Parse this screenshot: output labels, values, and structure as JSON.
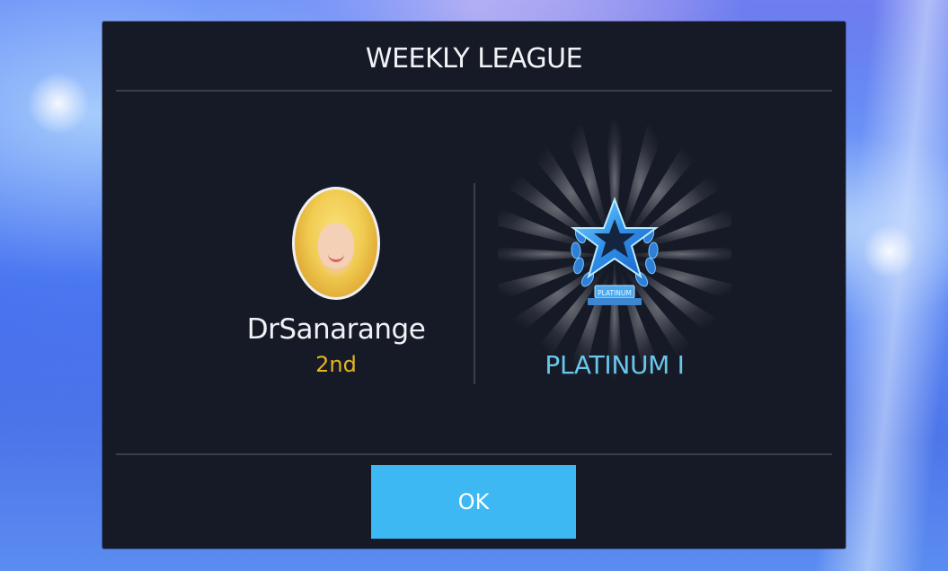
{
  "dialog": {
    "title": "WEEKLY LEAGUE",
    "ok_label": "OK"
  },
  "player": {
    "name": "DrSanarange",
    "rank": "2nd",
    "avatar_icon": "profile-photo"
  },
  "league": {
    "tier": "PLATINUM I",
    "badge_text": "PLATINUM",
    "trophy_icon": "star-trophy-icon"
  },
  "colors": {
    "dialog_bg": "#161a27",
    "rank": "#e4b421",
    "tier": "#69c7ec",
    "button": "#3db8f3"
  }
}
